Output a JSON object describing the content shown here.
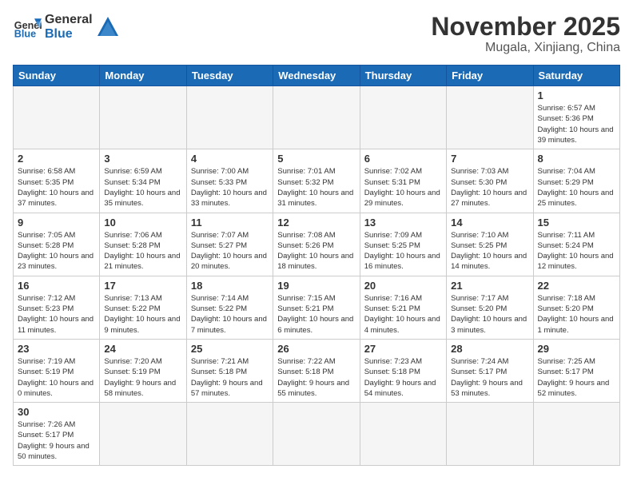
{
  "header": {
    "logo_general": "General",
    "logo_blue": "Blue",
    "month": "November 2025",
    "location": "Mugala, Xinjiang, China"
  },
  "weekdays": [
    "Sunday",
    "Monday",
    "Tuesday",
    "Wednesday",
    "Thursday",
    "Friday",
    "Saturday"
  ],
  "weeks": [
    [
      {
        "day": "",
        "info": ""
      },
      {
        "day": "",
        "info": ""
      },
      {
        "day": "",
        "info": ""
      },
      {
        "day": "",
        "info": ""
      },
      {
        "day": "",
        "info": ""
      },
      {
        "day": "",
        "info": ""
      },
      {
        "day": "1",
        "info": "Sunrise: 6:57 AM\nSunset: 5:36 PM\nDaylight: 10 hours\nand 39 minutes."
      }
    ],
    [
      {
        "day": "2",
        "info": "Sunrise: 6:58 AM\nSunset: 5:35 PM\nDaylight: 10 hours\nand 37 minutes."
      },
      {
        "day": "3",
        "info": "Sunrise: 6:59 AM\nSunset: 5:34 PM\nDaylight: 10 hours\nand 35 minutes."
      },
      {
        "day": "4",
        "info": "Sunrise: 7:00 AM\nSunset: 5:33 PM\nDaylight: 10 hours\nand 33 minutes."
      },
      {
        "day": "5",
        "info": "Sunrise: 7:01 AM\nSunset: 5:32 PM\nDaylight: 10 hours\nand 31 minutes."
      },
      {
        "day": "6",
        "info": "Sunrise: 7:02 AM\nSunset: 5:31 PM\nDaylight: 10 hours\nand 29 minutes."
      },
      {
        "day": "7",
        "info": "Sunrise: 7:03 AM\nSunset: 5:30 PM\nDaylight: 10 hours\nand 27 minutes."
      },
      {
        "day": "8",
        "info": "Sunrise: 7:04 AM\nSunset: 5:29 PM\nDaylight: 10 hours\nand 25 minutes."
      }
    ],
    [
      {
        "day": "9",
        "info": "Sunrise: 7:05 AM\nSunset: 5:28 PM\nDaylight: 10 hours\nand 23 minutes."
      },
      {
        "day": "10",
        "info": "Sunrise: 7:06 AM\nSunset: 5:28 PM\nDaylight: 10 hours\nand 21 minutes."
      },
      {
        "day": "11",
        "info": "Sunrise: 7:07 AM\nSunset: 5:27 PM\nDaylight: 10 hours\nand 20 minutes."
      },
      {
        "day": "12",
        "info": "Sunrise: 7:08 AM\nSunset: 5:26 PM\nDaylight: 10 hours\nand 18 minutes."
      },
      {
        "day": "13",
        "info": "Sunrise: 7:09 AM\nSunset: 5:25 PM\nDaylight: 10 hours\nand 16 minutes."
      },
      {
        "day": "14",
        "info": "Sunrise: 7:10 AM\nSunset: 5:25 PM\nDaylight: 10 hours\nand 14 minutes."
      },
      {
        "day": "15",
        "info": "Sunrise: 7:11 AM\nSunset: 5:24 PM\nDaylight: 10 hours\nand 12 minutes."
      }
    ],
    [
      {
        "day": "16",
        "info": "Sunrise: 7:12 AM\nSunset: 5:23 PM\nDaylight: 10 hours\nand 11 minutes."
      },
      {
        "day": "17",
        "info": "Sunrise: 7:13 AM\nSunset: 5:22 PM\nDaylight: 10 hours\nand 9 minutes."
      },
      {
        "day": "18",
        "info": "Sunrise: 7:14 AM\nSunset: 5:22 PM\nDaylight: 10 hours\nand 7 minutes."
      },
      {
        "day": "19",
        "info": "Sunrise: 7:15 AM\nSunset: 5:21 PM\nDaylight: 10 hours\nand 6 minutes."
      },
      {
        "day": "20",
        "info": "Sunrise: 7:16 AM\nSunset: 5:21 PM\nDaylight: 10 hours\nand 4 minutes."
      },
      {
        "day": "21",
        "info": "Sunrise: 7:17 AM\nSunset: 5:20 PM\nDaylight: 10 hours\nand 3 minutes."
      },
      {
        "day": "22",
        "info": "Sunrise: 7:18 AM\nSunset: 5:20 PM\nDaylight: 10 hours\nand 1 minute."
      }
    ],
    [
      {
        "day": "23",
        "info": "Sunrise: 7:19 AM\nSunset: 5:19 PM\nDaylight: 10 hours\nand 0 minutes."
      },
      {
        "day": "24",
        "info": "Sunrise: 7:20 AM\nSunset: 5:19 PM\nDaylight: 9 hours\nand 58 minutes."
      },
      {
        "day": "25",
        "info": "Sunrise: 7:21 AM\nSunset: 5:18 PM\nDaylight: 9 hours\nand 57 minutes."
      },
      {
        "day": "26",
        "info": "Sunrise: 7:22 AM\nSunset: 5:18 PM\nDaylight: 9 hours\nand 55 minutes."
      },
      {
        "day": "27",
        "info": "Sunrise: 7:23 AM\nSunset: 5:18 PM\nDaylight: 9 hours\nand 54 minutes."
      },
      {
        "day": "28",
        "info": "Sunrise: 7:24 AM\nSunset: 5:17 PM\nDaylight: 9 hours\nand 53 minutes."
      },
      {
        "day": "29",
        "info": "Sunrise: 7:25 AM\nSunset: 5:17 PM\nDaylight: 9 hours\nand 52 minutes."
      }
    ],
    [
      {
        "day": "30",
        "info": "Sunrise: 7:26 AM\nSunset: 5:17 PM\nDaylight: 9 hours\nand 50 minutes."
      },
      {
        "day": "",
        "info": ""
      },
      {
        "day": "",
        "info": ""
      },
      {
        "day": "",
        "info": ""
      },
      {
        "day": "",
        "info": ""
      },
      {
        "day": "",
        "info": ""
      },
      {
        "day": "",
        "info": ""
      }
    ]
  ]
}
